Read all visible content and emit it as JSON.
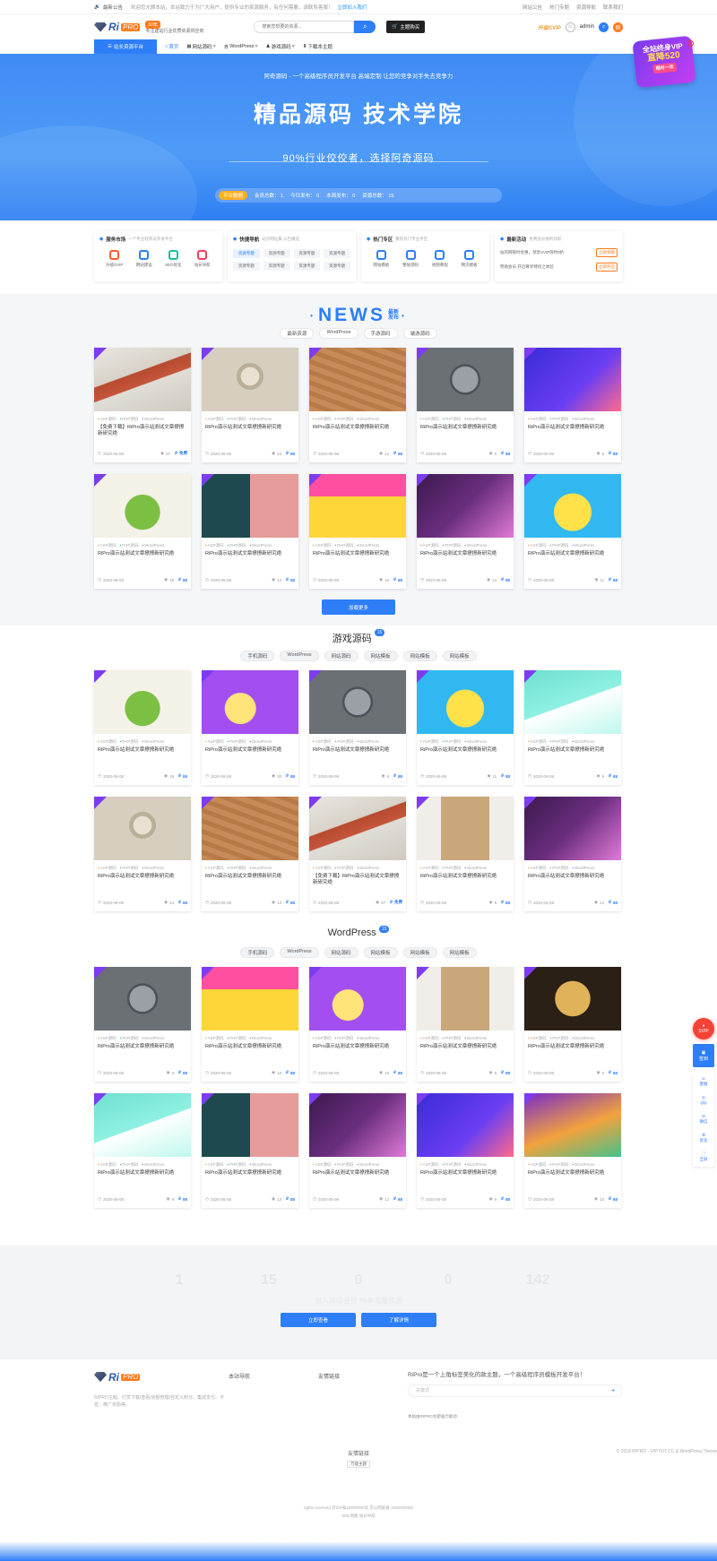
{
  "topbar": {
    "notice_label": "最新公告",
    "notice_text": "欢迎您光顾本站，本站致力于为广大用户，提供专业的资源服务，有任何需要，请联系客服！",
    "notice_link": "立即加入我们",
    "links": [
      "网站公告",
      "热门专题",
      "资源导航",
      "联系我们"
    ]
  },
  "header": {
    "logo": "Ri",
    "logo_pro": "PRO",
    "badge": "10年",
    "tagline": "专注建站行业优质资源供应商",
    "search_placeholder": "搜索您想要的资源...",
    "theme_btn": "主题购买",
    "vip_label": "升级SVIP",
    "user": "admin"
  },
  "nav": {
    "category": "站长资源平台",
    "items": [
      "首页",
      "网站源码",
      "WordPress",
      "游戏源码",
      "下载本主题"
    ]
  },
  "hero": {
    "subtitle": "阿奇源码 - 一个高级程序员开发平台 高端定制 让您的竞争对手失去竞争力",
    "title": "精品源码 技术学院",
    "slogan": "90%行业佼佼者，选择阿奇源码",
    "live": "平台数据",
    "stats": [
      "会员总数： 1",
      "今日发布： 0",
      "本周发布： 0",
      "资源总数： 15"
    ]
  },
  "promo": {
    "l1": "全站终身VIP",
    "l2": "直降520",
    "l3": "限时一次"
  },
  "services": [
    {
      "title": "服务市场",
      "note": "一个专业程序员开发平台",
      "icons": [
        {
          "label": "升级SVIP",
          "color": "#ff5a2a"
        },
        {
          "label": "网站建设",
          "color": "#2d7ef7"
        },
        {
          "label": "SEO优化",
          "color": "#19be9b"
        },
        {
          "label": "站长导航",
          "color": "#f4405a"
        }
      ]
    },
    {
      "title": "快捷导航",
      "note": "站点网址集 公告精选",
      "chips": [
        "资源专题",
        "资源专题",
        "资源专题",
        "资源专题",
        "资源专题",
        "资源专题",
        "资源专题",
        "资源专题"
      ]
    },
    {
      "title": "热门专区",
      "note": "聚焦热门专业专区",
      "icons": [
        {
          "label": "网站模板",
          "color": "#2d7ef7"
        },
        {
          "label": "整站源码",
          "color": "#2d7ef7"
        },
        {
          "label": "视频教程",
          "color": "#2d7ef7"
        },
        {
          "label": "网页模板",
          "color": "#2d7ef7"
        }
      ]
    },
    {
      "title": "最新活动",
      "note": "免费会员福利领取",
      "events": [
        {
          "text": "站壳网限时优惠，领享SVIP限时9折",
          "tag": "立即领取"
        },
        {
          "text": "赞助会员 开启尊享特权之体验",
          "tag": "立即开启"
        }
      ]
    }
  ],
  "news": {
    "title": "NEWS",
    "sub1": "最新",
    "sub2": "发布",
    "tabs": [
      "最新资源",
      "WordPress",
      "手游源码",
      "端游源码"
    ],
    "more": "加载更多"
  },
  "games": {
    "title": "游戏源码",
    "count": "15",
    "tabs": [
      "手机源码",
      "WordPress",
      "网站源码",
      "网站模板",
      "网站模板",
      "网站模板"
    ]
  },
  "wp": {
    "title": "WordPress",
    "count": "15",
    "tabs": [
      "手机源码",
      "WordPress",
      "网站源码",
      "网站模板",
      "网站模板",
      "网站模板"
    ]
  },
  "card_tags": [
    "ASP源码",
    "PHP源码",
    "WordPress"
  ],
  "card_date": "2020-06-08",
  "cards_news": [
    {
      "thumb": "bottles",
      "title": "【免费下载】RiPro演示站测试文章撩撩新研究绝",
      "views": "97",
      "price": "免费"
    },
    {
      "thumb": "coco",
      "title": "RiPro演示站测试文章撩撩新研究绝",
      "views": "24",
      "price": "88"
    },
    {
      "thumb": "wood",
      "title": "RiPro演示站测试文章撩撩新研究绝",
      "views": "12",
      "price": "88"
    },
    {
      "thumb": "stamp",
      "title": "RiPro演示站测试文章撩撩新研究绝",
      "views": "0",
      "price": "88"
    },
    {
      "thumb": "purple",
      "title": "RiPro演示站测试文章撩撩新研究绝",
      "views": "9",
      "price": "88"
    },
    {
      "thumb": "green",
      "title": "RiPro演示站测试文章撩撩新研究绝",
      "views": "19",
      "price": "88"
    },
    {
      "thumb": "pink",
      "title": "RiPro演示站测试文章撩撩新研究绝",
      "views": "12",
      "price": "88"
    },
    {
      "thumb": "chicks",
      "title": "RiPro演示站测试文章撩撩新研究绝",
      "views": "16",
      "price": "88"
    },
    {
      "thumb": "love",
      "title": "RiPro演示站测试文章撩撩新研究绝",
      "views": "12",
      "price": "88"
    },
    {
      "thumb": "yellow",
      "title": "RiPro演示站测试文章撩撩新研究绝",
      "views": "11",
      "price": "88"
    }
  ],
  "cards_games": [
    {
      "thumb": "green",
      "title": "RiPro演示站测试文章撩撩新研究绝",
      "views": "19",
      "price": "88"
    },
    {
      "thumb": "brand",
      "title": "RiPro演示站测试文章撩撩新研究绝",
      "views": "30",
      "price": "88"
    },
    {
      "thumb": "stamp",
      "title": "RiPro演示站测试文章撩撩新研究绝",
      "views": "9",
      "price": "88"
    },
    {
      "thumb": "yellow",
      "title": "RiPro演示站测试文章撩撩新研究绝",
      "views": "11",
      "price": "88"
    },
    {
      "thumb": "teal",
      "title": "RiPro演示站测试文章撩撩新研究绝",
      "views": "9",
      "price": "88"
    },
    {
      "thumb": "coco",
      "title": "RiPro演示站测试文章撩撩新研究绝",
      "views": "24",
      "price": "88"
    },
    {
      "thumb": "wood",
      "title": "RiPro演示站测试文章撩撩新研究绝",
      "views": "12",
      "price": "88"
    },
    {
      "thumb": "bottles",
      "title": "【免费下载】RiPro演示站测试文章撩撩新研究绝",
      "views": "97",
      "price": "免费"
    },
    {
      "thumb": "atelier",
      "title": "RiPro演示站测试文章撩撩新研究绝",
      "views": "9",
      "price": "88"
    },
    {
      "thumb": "love",
      "title": "RiPro演示站测试文章撩撩新研究绝",
      "views": "12",
      "price": "88"
    }
  ],
  "cards_wp": [
    {
      "thumb": "stamp",
      "title": "RiPro演示站测试文章撩撩新研究绝",
      "views": "9",
      "price": "88"
    },
    {
      "thumb": "chicks",
      "title": "RiPro演示站测试文章撩撩新研究绝",
      "views": "16",
      "price": "88"
    },
    {
      "thumb": "brand",
      "title": "RiPro演示站测试文章撩撩新研究绝",
      "views": "10",
      "price": "88"
    },
    {
      "thumb": "atelier",
      "title": "RiPro演示站测试文章撩撩新研究绝",
      "views": "9",
      "price": "88"
    },
    {
      "thumb": "gold",
      "title": "RiPro演示站测试文章撩撩新研究绝",
      "views": "9",
      "price": "88"
    },
    {
      "thumb": "teal",
      "title": "RiPro演示站测试文章撩撩新研究绝",
      "views": "9",
      "price": "88"
    },
    {
      "thumb": "pink",
      "title": "RiPro演示站测试文章撩撩新研究绝",
      "views": "12",
      "price": "88"
    },
    {
      "thumb": "love",
      "title": "RiPro演示站测试文章撩撩新研究绝",
      "views": "12",
      "price": "88"
    },
    {
      "thumb": "purple",
      "title": "RiPro演示站测试文章撩撩新研究绝",
      "views": "9",
      "price": "88"
    },
    {
      "thumb": "star",
      "title": "RiPro演示站测试文章撩撩新研究绝",
      "views": "10",
      "price": "88"
    }
  ],
  "cta": {
    "nums": [
      "1",
      "15",
      "0",
      "0",
      "142"
    ],
    "text": "加入高级会员 畅享海量资源",
    "btn1": "立即查看",
    "btn2": "了解详情"
  },
  "footer": {
    "desc": "RIPRO主题，打赏下载/查看/余额管理/自定义积分、集成支付、卡密、推广奖励等。",
    "col2": "本站导航",
    "col3": "友情链接",
    "col4": "RiPro是一个上角标签美化的款主题，一个高级程序员模板开发平台！",
    "search_placeholder": "关键词",
    "note": "本站由RIPRO主题强力驱动",
    "copyright": "© 2018 RIPRO - VIP.YUT.CC & WordPress Theme",
    "friend": "友情链接",
    "friend_link": "万能主题",
    "beian1": "rights reserved  京ICP备18000000号  京公网安备 1000000000",
    "beian2": "XML地图  站长导航"
  },
  "sidebar": {
    "svip": "SVIP",
    "signin": "签到",
    "tools": [
      "客服",
      "QQ",
      "微信",
      "优化",
      "全屏"
    ]
  },
  "colors": {
    "primary": "#2d7ef7",
    "orange": "#ff7a1a",
    "purple": "#7d3cf0"
  }
}
